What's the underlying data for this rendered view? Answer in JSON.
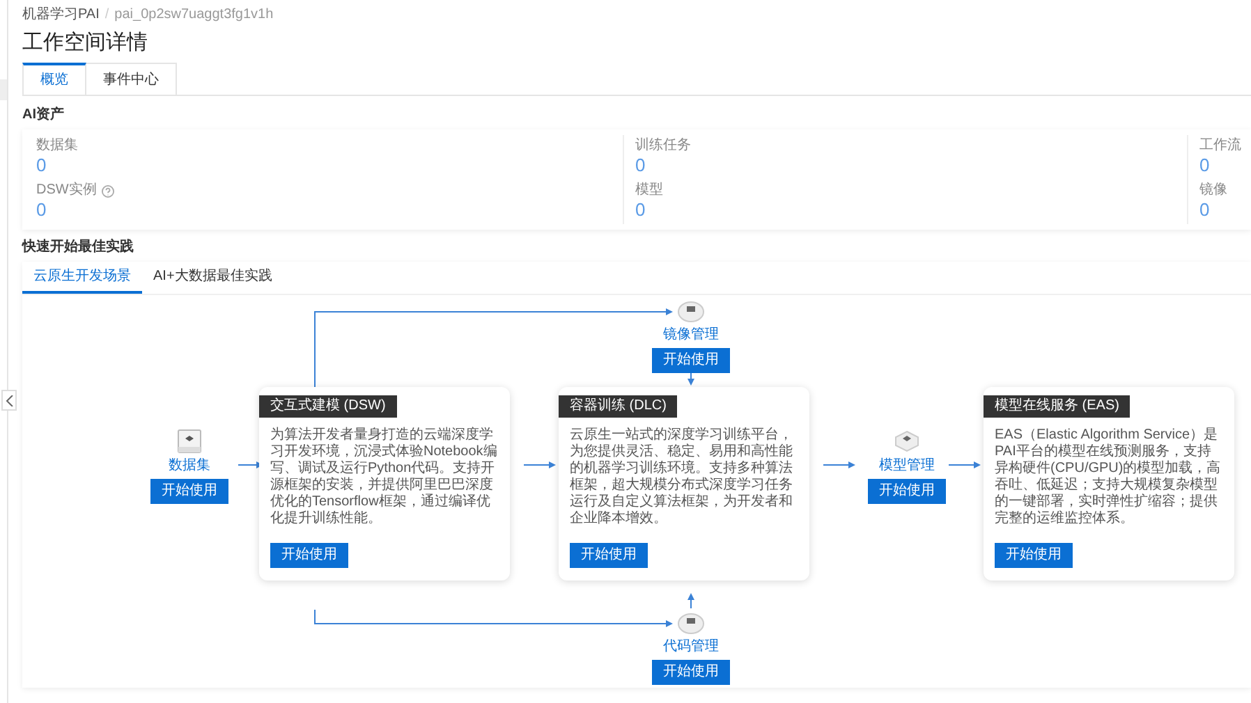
{
  "breadcrumb": {
    "items": [
      "机器学习PAI",
      "pai_0p2sw7uaggt3fg1v1h"
    ],
    "separator": "/"
  },
  "title": "工作空间详情",
  "tabs": [
    {
      "label": "概览",
      "selected": true
    },
    {
      "label": "事件中心",
      "selected": false
    }
  ],
  "assets": {
    "title": "AI资产",
    "items": [
      {
        "label": "数据集",
        "value": "0",
        "help": false
      },
      {
        "label": "训练任务",
        "value": "0",
        "help": false
      },
      {
        "label": "工作流",
        "value": "0",
        "help": false
      },
      {
        "label": "DSW实例",
        "value": "0",
        "help": true
      },
      {
        "label": "模型",
        "value": "0",
        "help": false
      },
      {
        "label": "镜像",
        "value": "0",
        "help": false
      }
    ]
  },
  "quickstart": {
    "title": "快速开始最佳实践",
    "tabs": [
      {
        "label": "云原生开发场景",
        "selected": true
      },
      {
        "label": "AI+大数据最佳实践",
        "selected": false
      }
    ],
    "nodes": [
      {
        "kind": "node",
        "label": "数据集",
        "button": "开始使用"
      },
      {
        "kind": "card",
        "title": "交互式建模 (DSW)",
        "description": "为算法开发者量身打造的云端深度学习开发环境，沉浸式体验Notebook编写、调试及运行Python代码。支持开源框架的安装，并提供阿里巴巴深度优化的Tensorflow框架，通过编译优化提升训练性能。",
        "button": "开始使用"
      },
      {
        "kind": "card",
        "title": "容器训练 (DLC)",
        "description": "云原生一站式的深度学习训练平台，为您提供灵活、稳定、易用和高性能的机器学习训练环境。支持多种算法框架，超大规模分布式深度学习任务运行及自定义算法框架，为开发者和企业降本增效。",
        "button": "开始使用"
      },
      {
        "kind": "node",
        "label": "模型管理",
        "button": "开始使用"
      },
      {
        "kind": "card",
        "title": "模型在线服务 (EAS)",
        "description": "EAS（Elastic Algorithm Service）是PAI平台的模型在线预测服务，支持异构硬件(CPU/GPU)的模型加载，高吞吐、低延迟；支持大规模复杂模型的一键部署，实时弹性扩缩容；提供完整的运维监控体系。",
        "button": "开始使用"
      },
      {
        "kind": "node",
        "label": "镜像管理",
        "button": "开始使用"
      },
      {
        "kind": "node",
        "label": "代码管理",
        "button": "开始使用"
      }
    ]
  }
}
